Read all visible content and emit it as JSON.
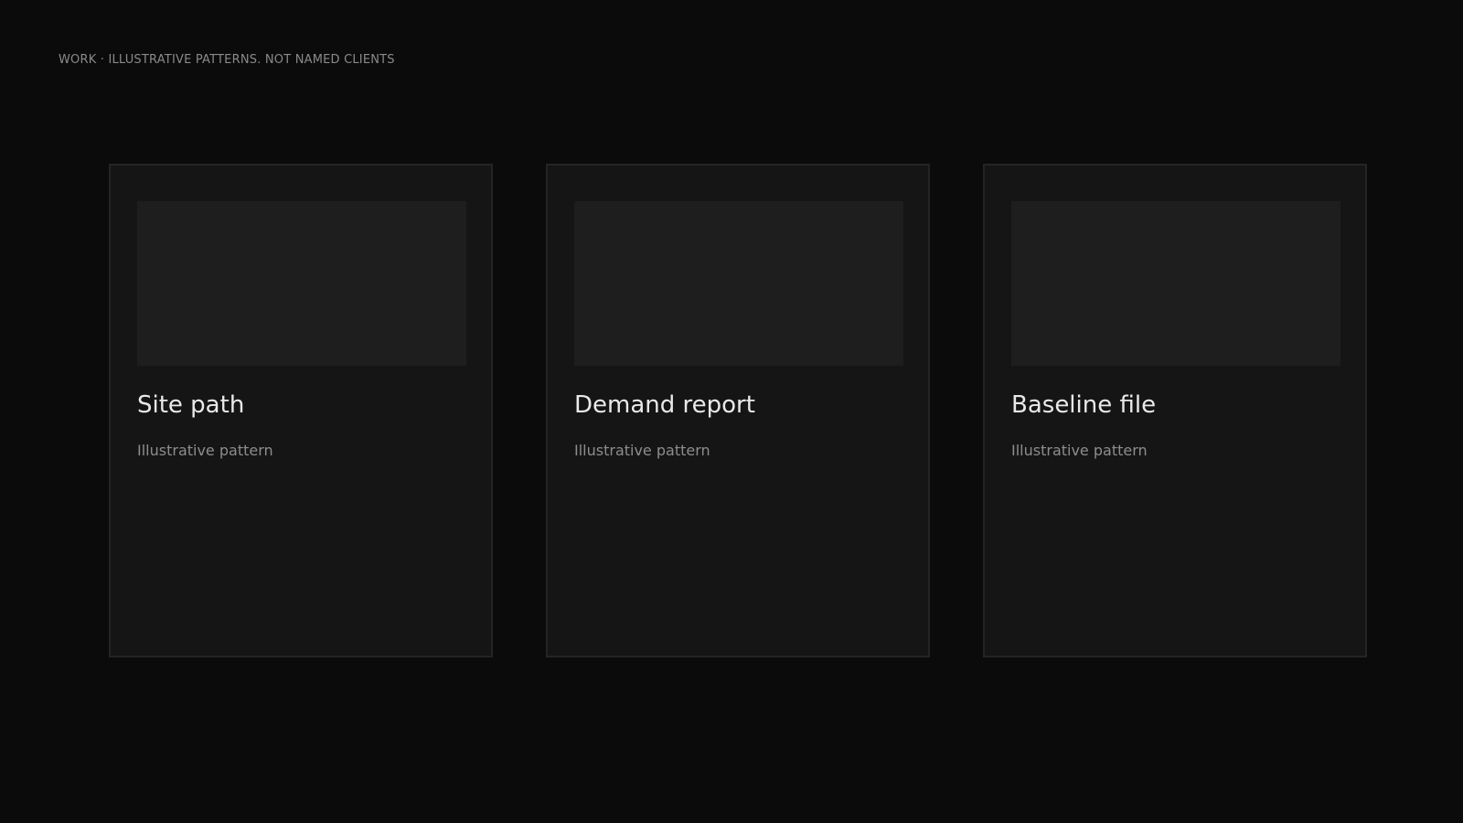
{
  "header": {
    "label": "WORK · ILLUSTRATIVE PATTERNS. NOT NAMED CLIENTS"
  },
  "cards": [
    {
      "title": "Site path",
      "subtitle": "Illustrative pattern"
    },
    {
      "title": "Demand report",
      "subtitle": "Illustrative pattern"
    },
    {
      "title": "Baseline file",
      "subtitle": "Illustrative pattern"
    }
  ],
  "colors": {
    "background": "#0b0b0b",
    "card": "#151515",
    "card_border": "#242424",
    "thumbnail": "#1e1e1e",
    "title_text": "#e9e9e9",
    "muted_text": "#8d8d8d"
  }
}
